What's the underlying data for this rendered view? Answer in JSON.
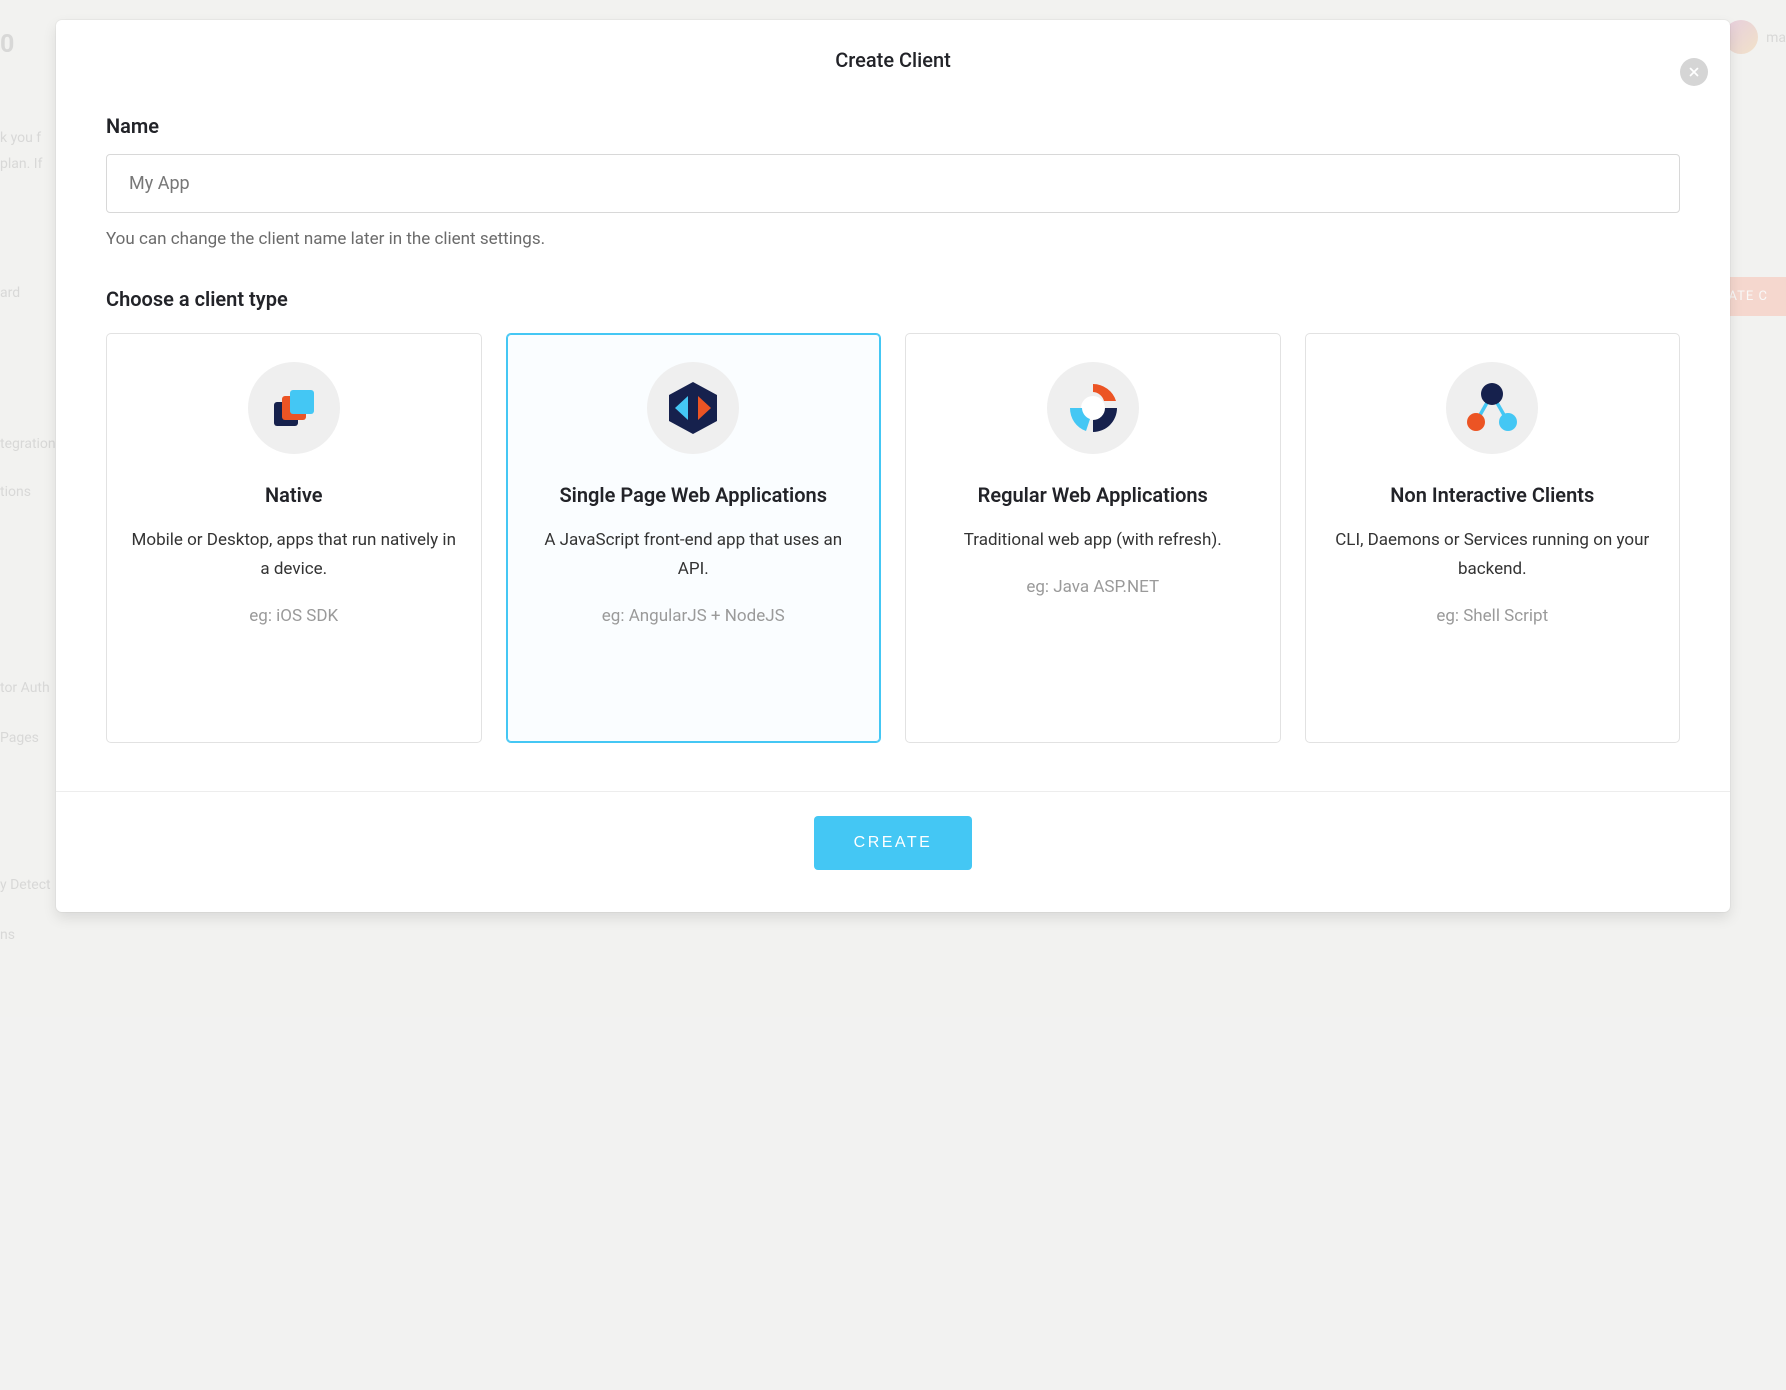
{
  "background": {
    "brand_fragment": "0",
    "logged_in_as": "ma",
    "dashboard_label": "ard",
    "integrations_label": "tegrations",
    "extensions_label": "tions",
    "multifactor_label": "tor Auth",
    "pages_label": "Pages",
    "anomaly_label": "y Detect",
    "logs_label": "ns",
    "trial_line1": "k you f",
    "trial_line2": "plan. If",
    "create_client_btn": "REATE C"
  },
  "modal": {
    "title": "Create Client",
    "name_label": "Name",
    "name_placeholder": "My App",
    "name_helper": "You can change the client name later in the client settings.",
    "choose_label": "Choose a client type",
    "create_button": "CREATE",
    "selected_index": 1,
    "client_types": [
      {
        "title": "Native",
        "description": "Mobile or Desktop, apps that run natively in a device.",
        "example": "eg: iOS SDK"
      },
      {
        "title": "Single Page Web Applications",
        "description": "A JavaScript front-end app that uses an API.",
        "example": "eg: AngularJS + NodeJS"
      },
      {
        "title": "Regular Web Applications",
        "description": "Traditional web app (with refresh).",
        "example": "eg: Java ASP.NET"
      },
      {
        "title": "Non Interactive Clients",
        "description": "CLI, Daemons or Services running on your backend.",
        "example": "eg: Shell Script"
      }
    ]
  }
}
